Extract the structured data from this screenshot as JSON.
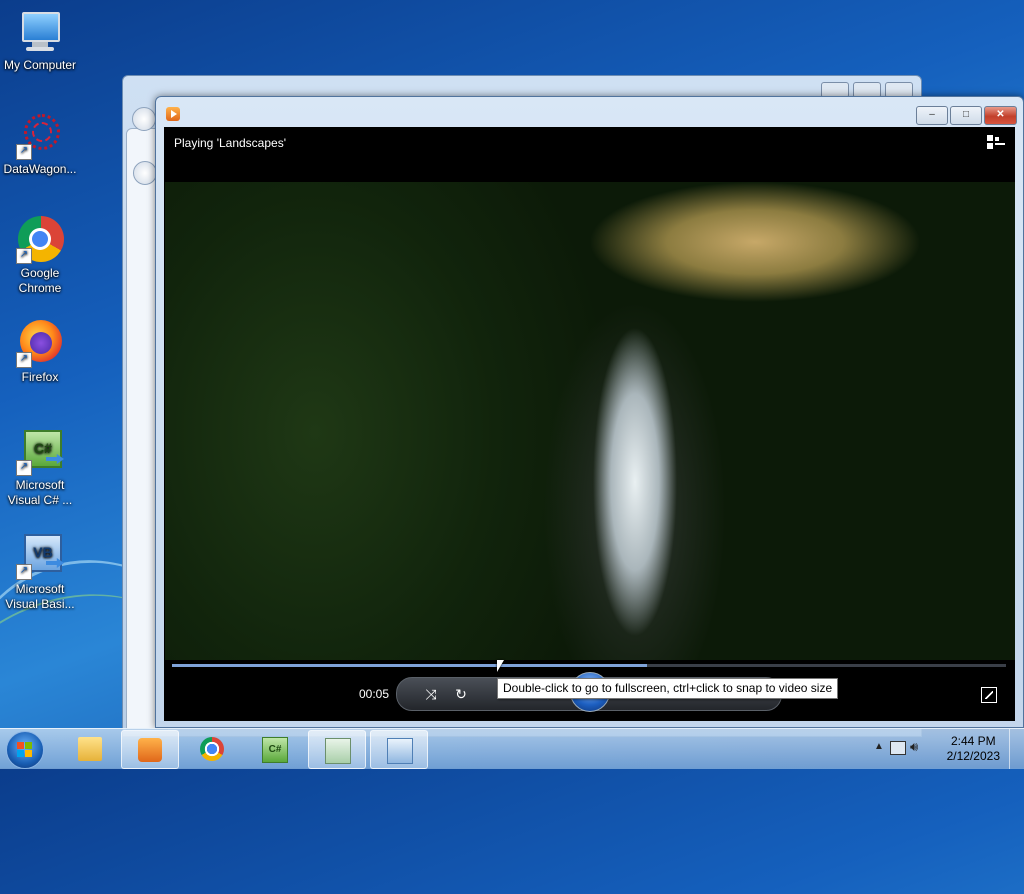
{
  "desktop": {
    "icons": [
      {
        "label": "My Computer",
        "icon": "computer-icon"
      },
      {
        "label": "DataWagon...",
        "icon": "datawagon-icon"
      },
      {
        "label": "Google Chrome",
        "icon": "chrome-icon"
      },
      {
        "label": "Firefox",
        "icon": "firefox-icon"
      },
      {
        "label": "Microsoft Visual C# ...",
        "icon": "visual-csharp-icon"
      },
      {
        "label": "Microsoft Visual Basi...",
        "icon": "visual-basic-icon"
      }
    ]
  },
  "player": {
    "now_playing": "Playing 'Landscapes'",
    "elapsed": "00:05",
    "progress_fraction": 0.57,
    "tooltip": "Double-click to go to fullscreen, ctrl+click to snap to video size",
    "window_controls": {
      "minimize": "–",
      "maximize": "□",
      "close": "✕"
    }
  },
  "taskbar": {
    "items": [
      "start-orb",
      "file-explorer",
      "windows-media-player",
      "google-chrome",
      "visual-csharp",
      "notepad-document",
      "control-panel"
    ],
    "clock_time": "2:44 PM",
    "clock_date": "2/12/2023"
  },
  "colors": {
    "accent": "#1a5fb4",
    "seek_fill": "#7fa3d9",
    "close_button": "#c2402c"
  }
}
